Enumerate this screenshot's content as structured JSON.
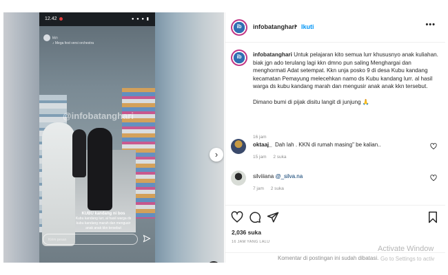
{
  "story": {
    "status_time": "12.42",
    "status_icons": "● ● ● ▮",
    "story_user": "kkn",
    "story_sub": "♪ Mega fest versi orchestra",
    "watermark": "@infobatanghari",
    "caption_title": "KUBU kandang ni bos",
    "caption_body": "Kubu kandang lurr, al hasil warga ds kubu kandang marah dan mengusir anak anak kkn tersebut",
    "reply_placeholder": "Kirim pesan"
  },
  "post": {
    "username": "infobatanghari",
    "separator": "•",
    "follow_label": "Ikuti",
    "more_label": "•••",
    "caption_user": "infobatanghari",
    "caption_text": "Untuk pelajaran kito semua lurr khususnyo anak kuliahan. biak jgn ado terulang lagi kkn dmno pun saling Menghargai dan menghormati Adat setempat. Kkn unja posko 9 di desa Kubu kandang kecamatan Pemayung melecehkan namo ds Kubu kandang lurr. al hasil warga ds kubu kandang marah dan mengusir anak anak kkn tersebut.",
    "caption_text_2": "Dimano bumi di pijak disitu langit di junjung 🙏",
    "caption_time": "16 jam",
    "likes": "2,036 suka",
    "post_time": "16 JAM YANG LALU",
    "comments_closed": "Komentar di postingan ini sudah dibatasi."
  },
  "comments": [
    {
      "user": "oktaaj_",
      "text": "Dah lah . KKN di rumah masing\" be kalian..",
      "time": "15 jam",
      "likes": "2 suka"
    },
    {
      "user": "silviiiana",
      "mention": "@_silva.na",
      "text": "",
      "time": "7 jam",
      "likes": "2 suka"
    }
  ],
  "os_overlay": {
    "activate_title": "Activate Window",
    "activate_sub": "Go to Settings to activ"
  },
  "colors": {
    "accent": "#0095f6",
    "text": "#262626",
    "muted": "#8e8e8e"
  }
}
